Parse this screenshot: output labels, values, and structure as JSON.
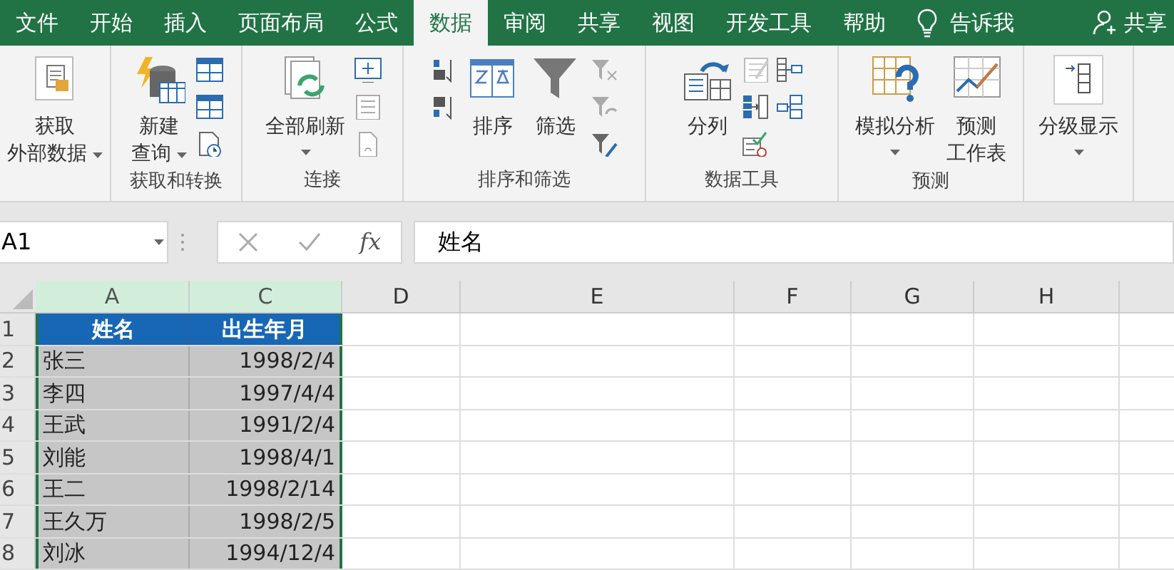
{
  "tabs": [
    {
      "label": "文件",
      "selected": false
    },
    {
      "label": "开始",
      "selected": false
    },
    {
      "label": "插入",
      "selected": false
    },
    {
      "label": "页面布局",
      "selected": false
    },
    {
      "label": "公式",
      "selected": false
    },
    {
      "label": "数据",
      "selected": true
    },
    {
      "label": "审阅",
      "selected": false
    },
    {
      "label": "共享",
      "selected": false
    },
    {
      "label": "视图",
      "selected": false
    },
    {
      "label": "开发工具",
      "selected": false
    },
    {
      "label": "帮助",
      "selected": false
    }
  ],
  "tell_me": "告诉我",
  "share": "共享",
  "ribbon_groups": [
    {
      "buttons": [
        {
          "lines": [
            "获取",
            "外部数据"
          ],
          "dropdown": true
        }
      ]
    },
    {
      "label": "获取和转换",
      "buttons": [
        {
          "lines": [
            "新建",
            "查询"
          ],
          "dropdown": true
        }
      ]
    },
    {
      "label": "连接",
      "buttons": [
        {
          "lines": [
            "全部刷新"
          ],
          "dropdown": true
        }
      ]
    },
    {
      "label": "排序和筛选",
      "buttons": [
        {
          "lines": [
            "排序"
          ],
          "dropdown": false
        },
        {
          "lines": [
            "筛选"
          ],
          "dropdown": false
        }
      ]
    },
    {
      "label": "数据工具",
      "buttons": [
        {
          "lines": [
            "分列"
          ],
          "dropdown": false
        }
      ]
    },
    {
      "label": "预测",
      "buttons": [
        {
          "lines": [
            "模拟分析"
          ],
          "dropdown": true
        },
        {
          "lines": [
            "预测",
            "工作表"
          ],
          "dropdown": false
        }
      ]
    },
    {
      "buttons": [
        {
          "lines": [
            "分级显示"
          ],
          "dropdown": true
        }
      ]
    }
  ],
  "name_box": "A1",
  "function_symbol": "fx",
  "formula": "姓名",
  "columns": [
    {
      "label": "A",
      "selected": true
    },
    {
      "label": "C",
      "selected": true
    },
    {
      "label": "D",
      "selected": false
    },
    {
      "label": "E",
      "selected": false
    },
    {
      "label": "F",
      "selected": false
    },
    {
      "label": "G",
      "selected": false
    },
    {
      "label": "H",
      "selected": false
    }
  ],
  "rows": [
    {
      "number": "1",
      "kind": "header",
      "selected": true,
      "cells": [
        "姓名",
        "出生年月"
      ]
    },
    {
      "number": "2",
      "kind": "data",
      "selected": true,
      "cells": [
        "张三",
        "1998/2/4"
      ]
    },
    {
      "number": "3",
      "kind": "data",
      "selected": true,
      "cells": [
        "李四",
        "1997/4/4"
      ]
    },
    {
      "number": "4",
      "kind": "data",
      "selected": true,
      "cells": [
        "王武",
        "1991/2/4"
      ]
    },
    {
      "number": "5",
      "kind": "data",
      "selected": true,
      "cells": [
        "刘能",
        "1998/4/1"
      ]
    },
    {
      "number": "6",
      "kind": "data",
      "selected": true,
      "cells": [
        "王二",
        "1998/2/14"
      ]
    },
    {
      "number": "7",
      "kind": "data",
      "selected": true,
      "cells": [
        "王久万",
        "1998/2/5"
      ]
    },
    {
      "number": "8",
      "kind": "data",
      "selected": true,
      "cells": [
        "刘冰",
        "1994/12/4"
      ]
    }
  ]
}
